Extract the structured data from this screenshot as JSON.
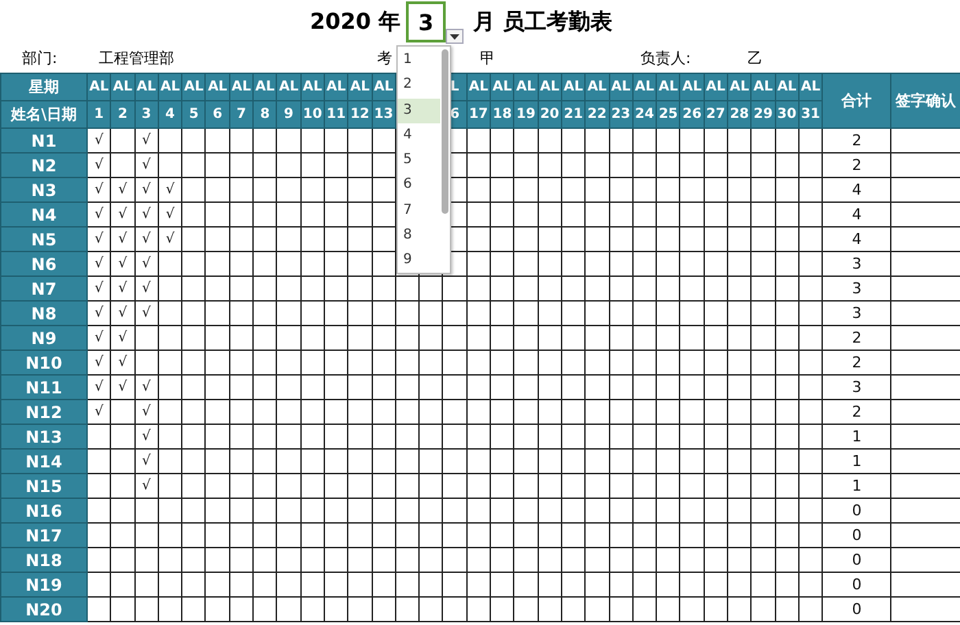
{
  "title": {
    "year": "2020 年",
    "month": "3",
    "suffix": "月 员工考勤表"
  },
  "info": [
    {
      "label": "部门:",
      "value": "工程管理部"
    },
    {
      "label": "考",
      "value": "甲"
    },
    {
      "label": "负责人:",
      "value": "乙"
    }
  ],
  "table": {
    "corner_week": "星期",
    "corner_name": "姓名\\日期",
    "total_header": "合计",
    "sign_header": "签字确认",
    "columns_before_dropdown": [
      {
        "weekday": "AL",
        "day": "1"
      },
      {
        "weekday": "AL",
        "day": "2"
      },
      {
        "weekday": "AL",
        "day": "3"
      },
      {
        "weekday": "AL",
        "day": "4"
      },
      {
        "weekday": "AL",
        "day": "5"
      },
      {
        "weekday": "AL",
        "day": "6"
      },
      {
        "weekday": "AL",
        "day": "7"
      },
      {
        "weekday": "AL",
        "day": "8"
      },
      {
        "weekday": "AL",
        "day": "9"
      },
      {
        "weekday": "AL",
        "day": "10"
      },
      {
        "weekday": "AL",
        "day": "11"
      },
      {
        "weekday": "AL",
        "day": "12"
      },
      {
        "weekday": "AL",
        "day": "13"
      }
    ],
    "check_mark": "√",
    "columns_after_dropdown": [
      {
        "weekday": "L",
        "day": "6"
      },
      {
        "weekday": "AL",
        "day": "17"
      },
      {
        "weekday": "AL",
        "day": "18"
      },
      {
        "weekday": "AL",
        "day": "19"
      },
      {
        "weekday": "AL",
        "day": "20"
      },
      {
        "weekday": "AL",
        "day": "21"
      },
      {
        "weekday": "AL",
        "day": "22"
      },
      {
        "weekday": "AL",
        "day": "23"
      },
      {
        "weekday": "AL",
        "day": "24"
      },
      {
        "weekday": "AL",
        "day": "25"
      },
      {
        "weekday": "AL",
        "day": "26"
      },
      {
        "weekday": "AL",
        "day": "27"
      },
      {
        "weekday": "AL",
        "day": "28"
      },
      {
        "weekday": "AL",
        "day": "29"
      },
      {
        "weekday": "AL",
        "day": "30"
      },
      {
        "weekday": "AL",
        "day": "31"
      }
    ],
    "rows": [
      {
        "name": "N1",
        "cells": [
          {
            "checked": true
          },
          {
            "checked": false
          },
          {
            "checked": true
          }
        ],
        "total": "2"
      },
      {
        "name": "N2",
        "cells": [
          {
            "checked": true
          },
          {
            "checked": false
          },
          {
            "checked": true
          }
        ],
        "total": "2"
      },
      {
        "name": "N3",
        "cells": [
          {
            "checked": true
          },
          {
            "checked": true
          },
          {
            "checked": true
          },
          {
            "checked": true
          }
        ],
        "total": "4"
      },
      {
        "name": "N4",
        "cells": [
          {
            "checked": true
          },
          {
            "checked": true
          },
          {
            "checked": true
          },
          {
            "checked": true
          }
        ],
        "total": "4"
      },
      {
        "name": "N5",
        "cells": [
          {
            "checked": true
          },
          {
            "checked": true
          },
          {
            "checked": true
          },
          {
            "checked": true
          }
        ],
        "total": "4"
      },
      {
        "name": "N6",
        "cells": [
          {
            "checked": true
          },
          {
            "checked": true
          },
          {
            "checked": true
          }
        ],
        "total": "3"
      },
      {
        "name": "N7",
        "cells": [
          {
            "checked": true
          },
          {
            "checked": true
          },
          {
            "checked": true
          }
        ],
        "total": "3"
      },
      {
        "name": "N8",
        "cells": [
          {
            "checked": true
          },
          {
            "checked": true
          },
          {
            "checked": true
          }
        ],
        "total": "3"
      },
      {
        "name": "N9",
        "cells": [
          {
            "checked": true
          },
          {
            "checked": true
          }
        ],
        "total": "2"
      },
      {
        "name": "N10",
        "cells": [
          {
            "checked": true
          },
          {
            "checked": true
          }
        ],
        "total": "2"
      },
      {
        "name": "N11",
        "cells": [
          {
            "checked": true
          },
          {
            "checked": true
          },
          {
            "checked": true
          }
        ],
        "total": "3"
      },
      {
        "name": "N12",
        "cells": [
          {
            "checked": true
          },
          {
            "checked": false
          },
          {
            "checked": true
          }
        ],
        "total": "2"
      },
      {
        "name": "N13",
        "cells": [
          {
            "checked": false
          },
          {
            "checked": false
          },
          {
            "checked": true
          }
        ],
        "total": "1"
      },
      {
        "name": "N14",
        "cells": [
          {
            "checked": false
          },
          {
            "checked": false
          },
          {
            "checked": true
          }
        ],
        "total": "1"
      },
      {
        "name": "N15",
        "cells": [
          {
            "checked": false
          },
          {
            "checked": false
          },
          {
            "checked": true
          }
        ],
        "total": "1"
      },
      {
        "name": "N16",
        "total": "0"
      },
      {
        "name": "N17",
        "total": "0"
      },
      {
        "name": "N18",
        "total": "0"
      },
      {
        "name": "N19",
        "total": "0"
      },
      {
        "name": "N20",
        "total": "0"
      }
    ]
  },
  "month_dropdown": {
    "options": [
      {
        "label": "1",
        "selected": false
      },
      {
        "label": "2",
        "selected": false
      },
      {
        "label": "3",
        "selected": true
      },
      {
        "label": "4",
        "selected": false
      },
      {
        "label": "5",
        "selected": false
      },
      {
        "label": "6",
        "selected": false
      },
      {
        "label": "7",
        "selected": false
      },
      {
        "label": "8",
        "selected": false
      },
      {
        "label": "9",
        "selected": false
      }
    ]
  }
}
